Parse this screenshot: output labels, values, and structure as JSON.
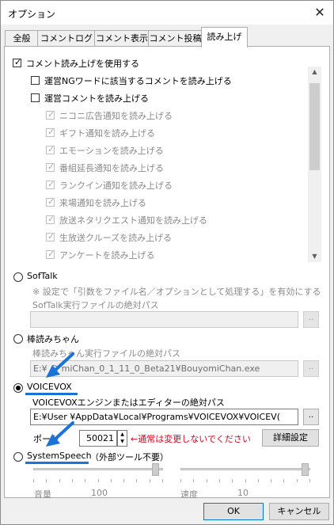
{
  "window": {
    "title": "オプション"
  },
  "tabs": [
    {
      "label": "全般"
    },
    {
      "label": "コメントログ"
    },
    {
      "label": "コメント表示"
    },
    {
      "label": "コメント投稿"
    },
    {
      "label": "読み上げ"
    }
  ],
  "main": {
    "use_reading": "コメント読み上げを使用する",
    "options": [
      {
        "label": "運営NGワードに該当するコメントを読み上げる",
        "checked": false,
        "enabled": true
      },
      {
        "label": "運営コメントを読み上げる",
        "checked": false,
        "enabled": true
      },
      {
        "label": "ニコニ広告通知を読み上げる",
        "checked": true,
        "enabled": false
      },
      {
        "label": "ギフト通知を読み上げる",
        "checked": true,
        "enabled": false
      },
      {
        "label": "エモーションを読み上げる",
        "checked": true,
        "enabled": false
      },
      {
        "label": "番組延長通知を読み上げる",
        "checked": true,
        "enabled": false
      },
      {
        "label": "ランクイン通知を読み上げる",
        "checked": true,
        "enabled": false
      },
      {
        "label": "来場通知を読み上げる",
        "checked": true,
        "enabled": false
      },
      {
        "label": "放送ネタリクエスト通知を読み上げる",
        "checked": true,
        "enabled": false
      },
      {
        "label": "生放送クルーズを読み上げる",
        "checked": true,
        "enabled": false
      },
      {
        "label": "アンケートを読み上げる",
        "checked": true,
        "enabled": false
      }
    ]
  },
  "softalk": {
    "label": "SofTalk",
    "note": "※ 設定で「引数をファイル名／オプションとして処理する」を有効にする",
    "path_label": "SofTalk実行ファイルの絶対パス",
    "path_value": "",
    "browse": ".."
  },
  "bouyomi": {
    "label": "棒読みちゃん",
    "path_label": "棒読みちゃん実行ファイルの絶対パス",
    "path_value": "E:¥ ミ miChan_0_1_11_0_Beta21¥BouyomiChan.exe",
    "browse": ".."
  },
  "voicevox": {
    "label": "VOICEVOX",
    "path_label": "VOICEVOXエンジンまたはエディターの絶対パス",
    "path_value": "E:¥User ¥AppData¥Local¥Programs¥VOICEVOX¥VOICEV(",
    "browse": "..",
    "port_label": "ポート",
    "port_value": "50021",
    "port_note": "←通常は変更しないでください",
    "advanced": "詳細設定"
  },
  "systemspeech": {
    "label": "SystemSpeech",
    "note": "（外部ツール不要）",
    "volume_label": "音量",
    "volume_value": "100",
    "rate_label": "速度",
    "rate_value": "10"
  },
  "footer": {
    "ok": "OK",
    "cancel": "キャンセル"
  },
  "colors": {
    "annotation_blue": "#1a74d8",
    "warning_red": "#e0001a"
  }
}
